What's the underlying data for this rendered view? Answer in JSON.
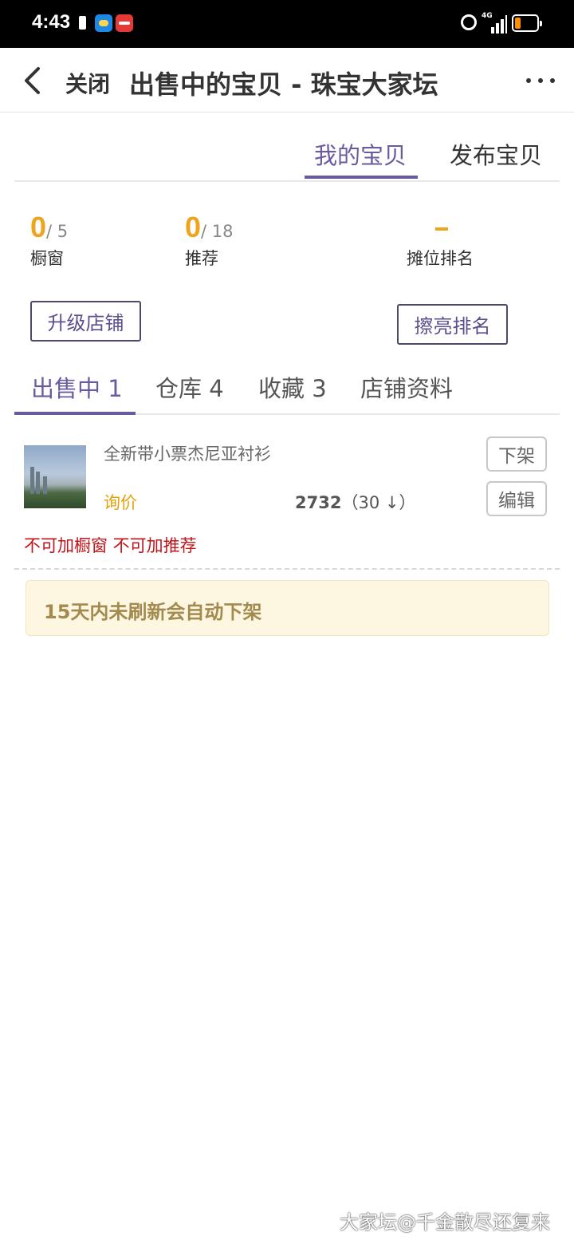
{
  "status_bar": {
    "time": "4:43",
    "network": "4G"
  },
  "header": {
    "back_icon": "chevron-left-icon",
    "close_label": "关闭",
    "title": "出售中的宝贝 - 珠宝大家坛",
    "more_icon": "more-horizontal-icon"
  },
  "top_tabs": [
    {
      "label": "我的宝贝",
      "active": true
    },
    {
      "label": "发布宝贝",
      "active": false
    }
  ],
  "stats": {
    "showcase": {
      "value": "0",
      "total": "/ 5",
      "label": "橱窗"
    },
    "recommend": {
      "value": "0",
      "total": "/ 18",
      "label": "推荐"
    },
    "rank": {
      "value": "-",
      "label": "摊位排名"
    }
  },
  "buttons": {
    "upgrade_store": "升级店铺",
    "polish_rank": "擦亮排名"
  },
  "sub_tabs": [
    {
      "label": "出售中 1",
      "active": true
    },
    {
      "label": "仓库 4",
      "active": false
    },
    {
      "label": "收藏 3",
      "active": false
    },
    {
      "label": "店铺资料",
      "active": false
    }
  ],
  "items": [
    {
      "name": "全新带小票杰尼亚衬衫",
      "price": "询价",
      "views": "2732",
      "views_extra": "（30 ↓）",
      "actions": {
        "delist": "下架",
        "edit": "编辑"
      },
      "warning": "不可加橱窗 不可加推荐"
    }
  ],
  "notice": "15天内未刷新会自动下架",
  "watermark": "大家坛@千金散尽还复来",
  "colors": {
    "accent": "#6a5ba0",
    "stat_orange": "#f0a31c",
    "warning_red": "#c0141b",
    "notice_bg": "#fdf6e0",
    "notice_text": "#a38a4e"
  }
}
